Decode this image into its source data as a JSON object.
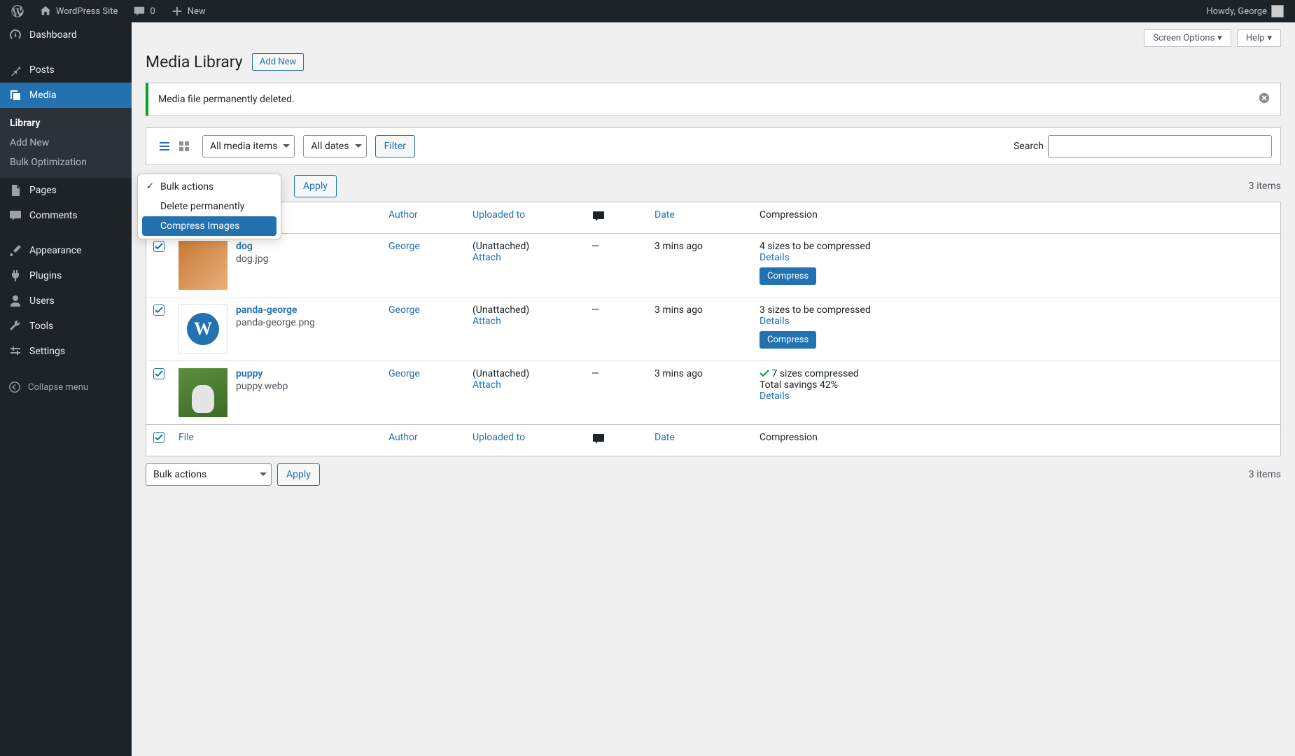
{
  "topbar": {
    "site_name": "WordPress Site",
    "comments_count": "0",
    "new_label": "New",
    "howdy": "Howdy, George"
  },
  "sidebar": {
    "dashboard": "Dashboard",
    "posts": "Posts",
    "media": "Media",
    "media_sub": {
      "library": "Library",
      "add_new": "Add New",
      "bulk_opt": "Bulk Optimization"
    },
    "pages": "Pages",
    "comments": "Comments",
    "appearance": "Appearance",
    "plugins": "Plugins",
    "users": "Users",
    "tools": "Tools",
    "settings": "Settings",
    "collapse": "Collapse menu"
  },
  "screen_meta": {
    "screen_options": "Screen Options",
    "help": "Help"
  },
  "page_title": "Media Library",
  "add_new": "Add New",
  "notice": "Media file permanently deleted.",
  "filters": {
    "type": "All media items",
    "date": "All dates",
    "filter_btn": "Filter",
    "search_label": "Search"
  },
  "bulk": {
    "selected": "Bulk actions",
    "options": [
      "Bulk actions",
      "Delete permanently",
      "Compress Images"
    ],
    "apply": "Apply"
  },
  "items_count": "3 items",
  "columns": {
    "file": "File",
    "author": "Author",
    "parent": "Uploaded to",
    "date": "Date",
    "compression": "Compression"
  },
  "rows": [
    {
      "title": "dog",
      "filename": "dog.jpg",
      "author": "George",
      "parent_text": "(Unattached)",
      "attach": "Attach",
      "comments": "—",
      "date": "3 mins ago",
      "comp_line": "4 sizes to be compressed",
      "details": "Details",
      "compress_btn": "Compress",
      "checked": true,
      "thumb": "dog"
    },
    {
      "title": "panda-george",
      "filename": "panda-george.png",
      "author": "George",
      "parent_text": "(Unattached)",
      "attach": "Attach",
      "comments": "—",
      "date": "3 mins ago",
      "comp_line": "3 sizes to be compressed",
      "details": "Details",
      "compress_btn": "Compress",
      "checked": true,
      "thumb": "panda"
    },
    {
      "title": "puppy",
      "filename": "puppy.webp",
      "author": "George",
      "parent_text": "(Unattached)",
      "attach": "Attach",
      "comments": "—",
      "date": "3 mins ago",
      "comp_line": "7 sizes compressed",
      "comp_line2": "Total savings 42%",
      "details": "Details",
      "checked": true,
      "thumb": "puppy",
      "done": true
    }
  ]
}
